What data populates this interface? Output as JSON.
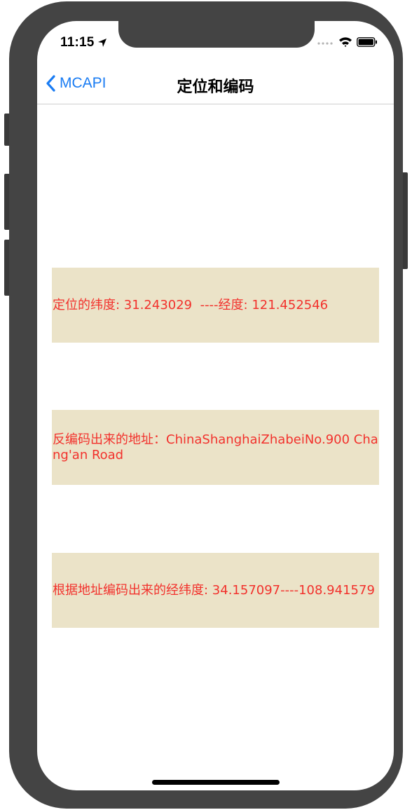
{
  "status_bar": {
    "time": "11:15",
    "icons": [
      "location-arrow-icon",
      "signal-dots-icon",
      "wifi-icon",
      "battery-icon"
    ]
  },
  "nav": {
    "back_label": "MCAPI",
    "title": "定位和编码"
  },
  "content": {
    "location_text": "定位的纬度: 31.243029  ----经度: 121.452546",
    "reverse_geocode_text": "反编码出来的地址：ChinaShanghaiZhabeiNo.900 Chang'an Road",
    "geocode_text": "根据地址编码出来的经纬度: 34.157097----108.941579"
  },
  "colors": {
    "accent": "#1a7cf3",
    "box_background": "#ebe3c8",
    "box_text": "#f2312c",
    "frame": "#444444"
  }
}
